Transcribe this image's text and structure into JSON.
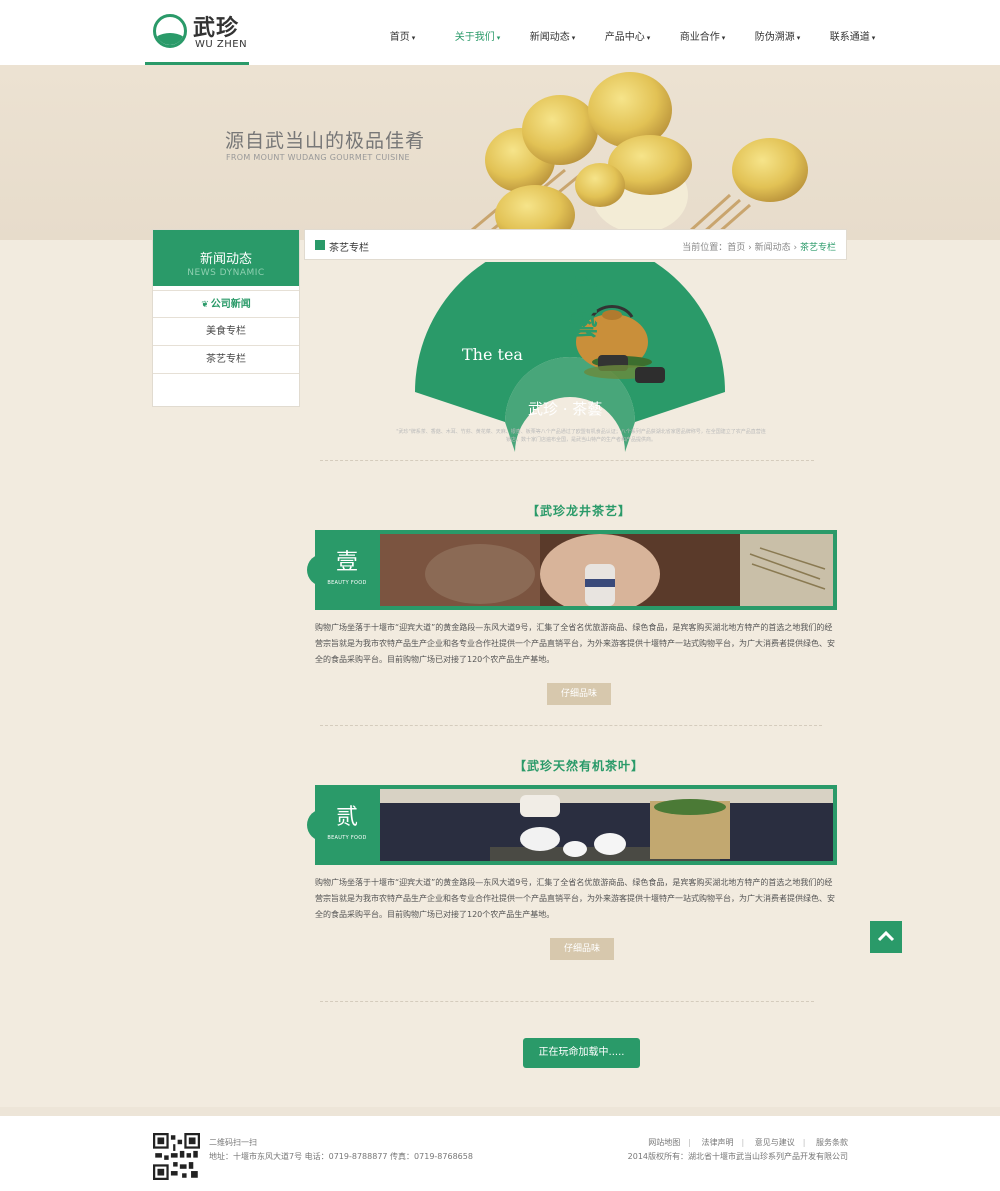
{
  "header": {
    "logo_cn": "武珍",
    "logo_en": "WU ZHEN",
    "nav": [
      {
        "label": "首页",
        "active": false
      },
      {
        "label": "关于我们",
        "active": true
      },
      {
        "label": "新闻动态",
        "active": false
      },
      {
        "label": "产品中心",
        "active": false
      },
      {
        "label": "商业合作",
        "active": false
      },
      {
        "label": "防伪溯源",
        "active": false
      },
      {
        "label": "联系通道",
        "active": false
      }
    ]
  },
  "banner": {
    "title": "源自武当山的极品佳肴",
    "subtitle": "FROM MOUNT WUDANG GOURMET CUISINE"
  },
  "sidebar": {
    "title_cn": "新闻动态",
    "title_en": "NEWS DYNAMIC",
    "items": [
      {
        "label": "公司新闻"
      },
      {
        "label": "美食专栏"
      },
      {
        "label": "茶艺专栏"
      }
    ]
  },
  "breadcrumb": {
    "title": "茶艺专栏",
    "prefix": "当前位置：",
    "path1": "首页",
    "sep": " › ",
    "path2": "新闻动态",
    "current": "茶艺专栏"
  },
  "fan": {
    "big_text": "茶藝",
    "en_text": "The tea",
    "bottom_text": "武珍 · 茶藝",
    "description": "\"武珍\"牌系茶、香菇、木耳、竹荪、黄花菜、天麻、银杏、板栗等八个产品通过了欧盟有机食品认证；八个系列产品获湖北省家居品牌称号，在全国建立了农产品直营连锁店，数十家门店遍布全国，是武当山特产的生产者和产品提供商。"
  },
  "sections": [
    {
      "title": "【武珍龙井茶艺】",
      "num_cn": "壹",
      "num_en": "BEAUTY FOOD",
      "text": "购物广场坐落于十堰市“迎宾大道”的黄金路段—东风大道9号，汇集了全省名优旅游商品、绿色食品，是宾客购买湖北地方特产的首选之地我们的经营宗旨就是为我市农特产品生产企业和各专业合作社提供一个产品直销平台，为外来游客提供十堰特产一站式购物平台，为广大消费者提供绿色、安全的食品采购平台。目前购物广场已对接了120个农产品生产基地。",
      "button": "仔细品味"
    },
    {
      "title": "【武珍天然有机茶叶】",
      "num_cn": "贰",
      "num_en": "BEAUTY FOOD",
      "text": "购物广场坐落于十堰市“迎宾大道”的黄金路段—东风大道9号，汇集了全省名优旅游商品、绿色食品，是宾客购买湖北地方特产的首选之地我们的经营宗旨就是为我市农特产品生产企业和各专业合作社提供一个产品直销平台，为外来游客提供十堰特产一站式购物平台，为广大消费者提供绿色、安全的食品采购平台。目前购物广场已对接了120个农产品生产基地。",
      "button": "仔细品味"
    }
  ],
  "load_more": "正在玩命加载中.....",
  "footer": {
    "qr_label": "二维码扫一扫",
    "address": "地址：十堰市东风大道7号   电话：0719-8788877   传真：0719-8768658",
    "links": [
      "网站地图",
      "法律声明",
      "意见与建议",
      "服务条款"
    ],
    "copyright": "2014版权所有：湖北省十堰市武当山珍系列产品开发有限公司"
  },
  "colors": {
    "brand_green": "#2a9a69",
    "page_bg": "#f2ebdf",
    "button_beige": "#d7c8ad"
  }
}
